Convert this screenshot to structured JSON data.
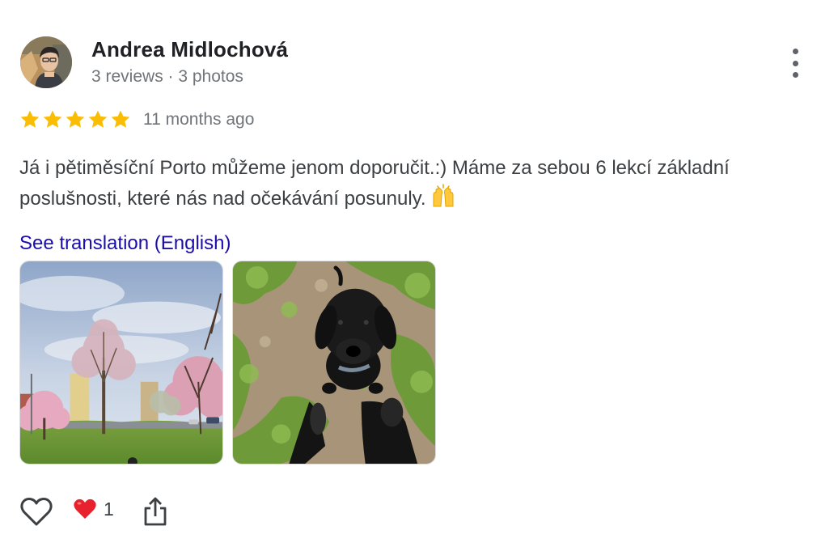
{
  "review": {
    "author": {
      "name": "Andrea Midlochová",
      "meta": "3 reviews · 3 photos"
    },
    "rating": {
      "stars": 5,
      "max": 5,
      "star_color": "#fbbc04",
      "time_ago": "11 months ago"
    },
    "text": "Já i pětiměsíční Porto můžeme jenom doporučit.:) Máme za sebou 6 lekcí základní poslušnosti, které nás nad očekávání posunuly.",
    "emoji_icon": "raising-hands-emoji",
    "translation_link": "See translation (English)",
    "link_color": "#1a0dab",
    "photos": [
      {
        "name": "park-cherry-blossom-photo"
      },
      {
        "name": "black-puppy-on-grass-photo"
      }
    ],
    "actions": {
      "like_icon": "heart-outline-icon",
      "reaction_icon": "red-heart-emoji",
      "reaction_count": "1",
      "share_icon": "share-icon"
    }
  }
}
